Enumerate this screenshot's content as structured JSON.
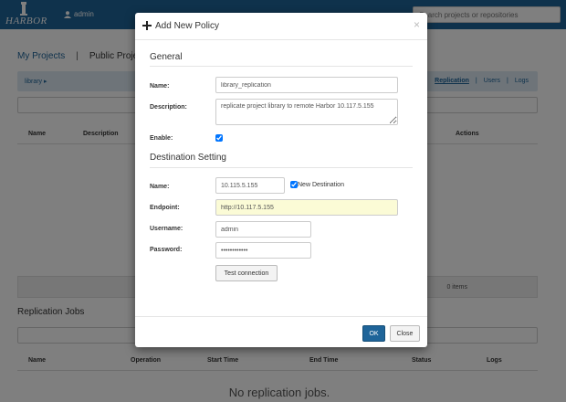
{
  "navbar": {
    "logo_text": "HARBOR",
    "username": "admin",
    "search_placeholder": "Search projects or repositories"
  },
  "project_tabs": {
    "my_projects": "My Projects",
    "separator": "|",
    "public_projects": "Public Projects"
  },
  "breadcrumb": {
    "project": "library",
    "arrow": "▸"
  },
  "sub_tabs": {
    "replication": "Replication",
    "users": "Users",
    "logs": "Logs",
    "separator": "|"
  },
  "policy_table": {
    "headers": {
      "name": "Name",
      "description": "Description",
      "actions": "Actions"
    },
    "pager": "0 items"
  },
  "jobs": {
    "title": "Replication Jobs",
    "headers": {
      "name": "Name",
      "operation": "Operation",
      "start_time": "Start Time",
      "end_time": "End Time",
      "status": "Status",
      "logs": "Logs"
    },
    "empty_message": "No replication jobs."
  },
  "modal": {
    "title": "Add New Policy",
    "close": "×",
    "general": {
      "heading": "General",
      "name_label": "Name:",
      "name_value": "library_replication",
      "description_label": "Description:",
      "description_value": "replicate project library to remote Harbor 10.117.5.155",
      "enable_label": "Enable:"
    },
    "destination": {
      "heading": "Destination Setting",
      "name_label": "Name:",
      "name_value": "10.115.5.155",
      "new_destination_label": "New Destination",
      "endpoint_label": "Endpoint:",
      "endpoint_value": "http://10.117.5.155",
      "username_label": "Username:",
      "username_value": "admin",
      "password_label": "Password:",
      "password_value": "••••••••••••",
      "test_button": "Test connection"
    },
    "ok_button": "OK",
    "close_button": "Close"
  }
}
